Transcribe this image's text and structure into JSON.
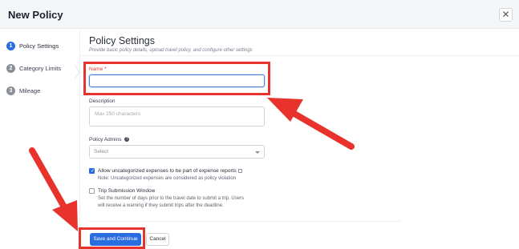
{
  "header": {
    "title": "New Policy",
    "close_glyph": "✕"
  },
  "sidebar": {
    "steps": [
      {
        "number": "1",
        "label": "Policy Settings",
        "state": "active"
      },
      {
        "number": "2",
        "label": "Category Limits",
        "state": "inactive"
      },
      {
        "number": "3",
        "label": "Mileage",
        "state": "inactive"
      }
    ]
  },
  "main": {
    "title": "Policy Settings",
    "subtitle": "Provide basic policy details, upload travel policy, and configure other settings",
    "name_field": {
      "label": "Name",
      "required_mark": "*",
      "value": "",
      "placeholder": ""
    },
    "description_field": {
      "label": "Description",
      "placeholder": "Max 250 characters"
    },
    "admins_field": {
      "label": "Policy Admins",
      "help_glyph": "?",
      "selected": "Select"
    },
    "uncategorized_option": {
      "label": "Allow uncategorized expenses to be part of expense reports",
      "note": "Note: Uncategorized expenses are considered as policy violation",
      "checked": true
    },
    "trip_option": {
      "label": "Trip Submission Window",
      "note_line1": "Set the number of days prior to the travel date to submit a trip. Users",
      "note_line2": "will receive a warning if they submit trips after the deadline.",
      "checked": false
    }
  },
  "footer": {
    "save_label": "Save and Continue",
    "cancel_label": "Cancel"
  },
  "colors": {
    "primary": "#2a6de0",
    "annotation": "#e8322c",
    "required": "#e03b3b"
  }
}
